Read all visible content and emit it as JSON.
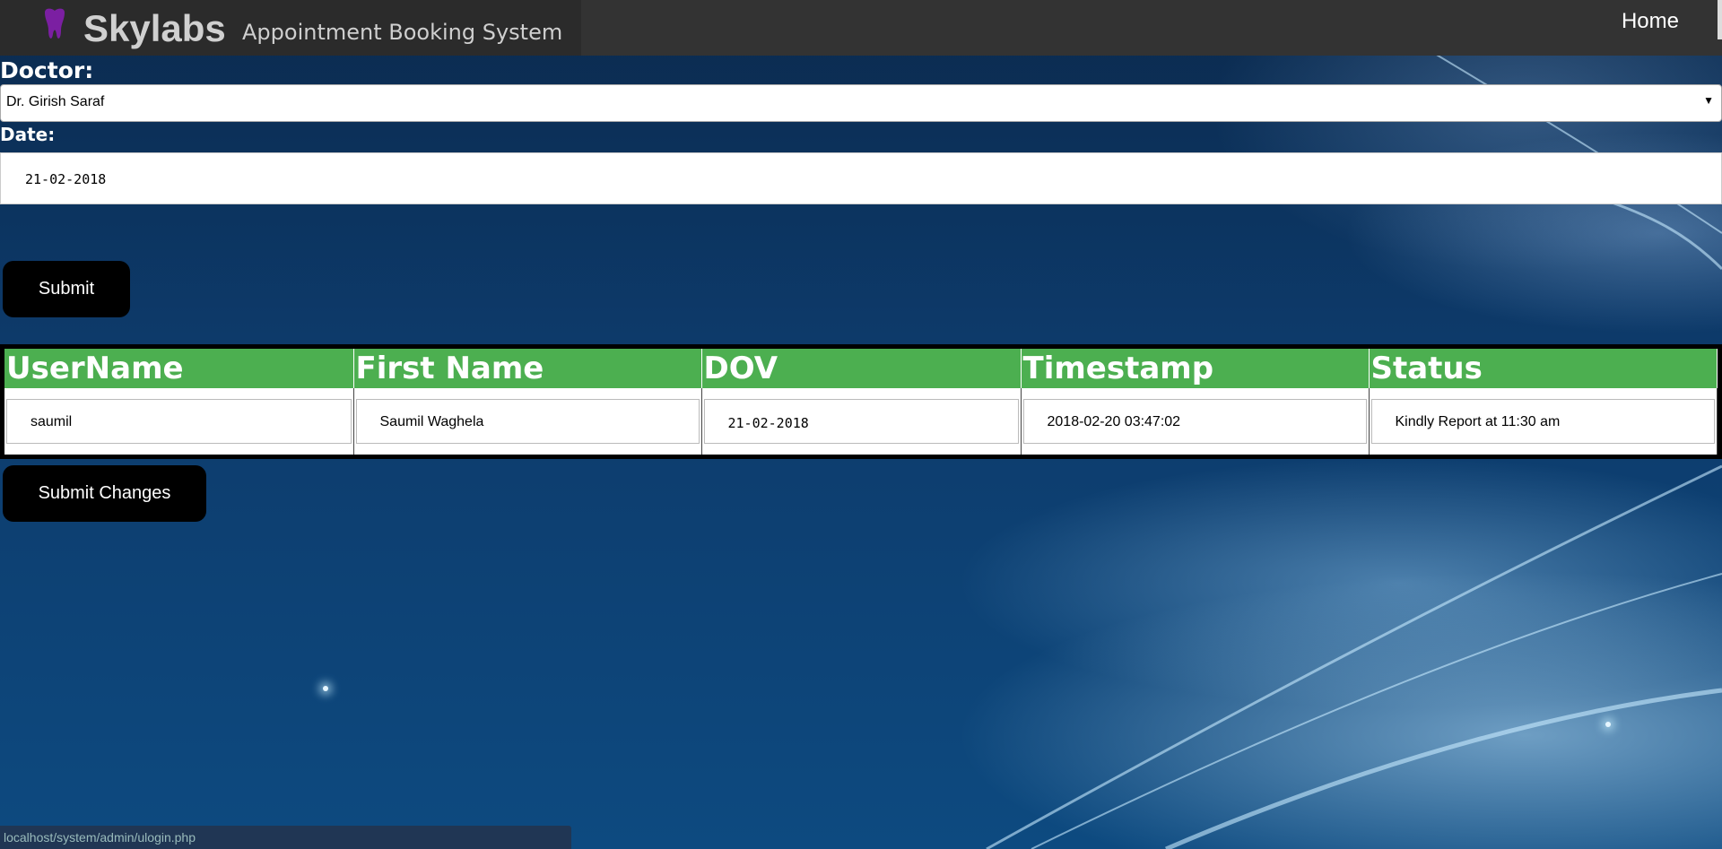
{
  "header": {
    "brand": "Skylabs",
    "subtitle": "Appointment Booking System",
    "home_link": "Home"
  },
  "form": {
    "doctor_label": "Doctor:",
    "doctor_selected": "Dr. Girish Saraf",
    "date_label": "Date:",
    "date_value": "21-02-2018",
    "submit_label": "Submit"
  },
  "table": {
    "columns": [
      "UserName",
      "First Name",
      "DOV",
      "Timestamp",
      "Status"
    ],
    "rows": [
      {
        "username": "saumil",
        "first_name": "Saumil Waghela",
        "dov": "21-02-2018",
        "timestamp": "2018-02-20 03:47:02",
        "status": "Kindly Report at 11:30 am"
      }
    ]
  },
  "submit_changes_label": "Submit Changes",
  "status_bar": {
    "url": "localhost/system/admin/ulogin.php"
  },
  "colors": {
    "header_bg": "#333333",
    "table_header": "#4caf50",
    "button_bg": "#000000",
    "tooth_icon": "#7b1fa2"
  }
}
